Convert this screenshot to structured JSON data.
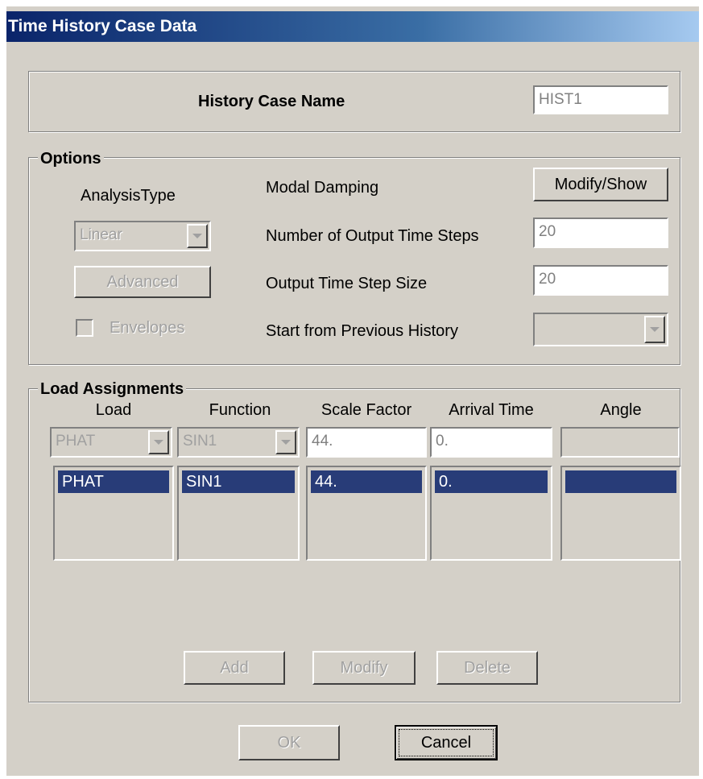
{
  "window": {
    "title": "Time History Case Data"
  },
  "history_case": {
    "label": "History Case Name",
    "value": "HIST1"
  },
  "options": {
    "legend": "Options",
    "analysis_type_label": "AnalysisType",
    "analysis_type_value": "Linear",
    "advanced_label": "Advanced",
    "envelopes_label": "Envelopes",
    "envelopes_checked": false,
    "modal_damping_label": "Modal Damping",
    "modify_show_label": "Modify/Show",
    "output_steps_label": "Number of Output Time Steps",
    "output_steps_value": "20",
    "step_size_label": "Output Time Step Size",
    "step_size_value": "20",
    "start_prev_label": "Start from Previous History",
    "start_prev_value": ""
  },
  "load_assignments": {
    "legend": "Load Assignments",
    "columns": [
      "Load",
      "Function",
      "Scale Factor",
      "Arrival Time",
      "Angle"
    ],
    "edit_row": {
      "load": "PHAT",
      "function": "SIN1",
      "scale_factor": "44.",
      "arrival_time": "0.",
      "angle": ""
    },
    "rows": [
      {
        "load": "PHAT",
        "function": "SIN1",
        "scale_factor": "44.",
        "arrival_time": "0.",
        "angle": ""
      }
    ],
    "add_label": "Add",
    "modify_label": "Modify",
    "delete_label": "Delete"
  },
  "footer": {
    "ok_label": "OK",
    "cancel_label": "Cancel"
  },
  "colors": {
    "title_start": "#0a246a",
    "title_end": "#a6caf0",
    "face": "#d4d0c8",
    "selection": "#283c78"
  }
}
